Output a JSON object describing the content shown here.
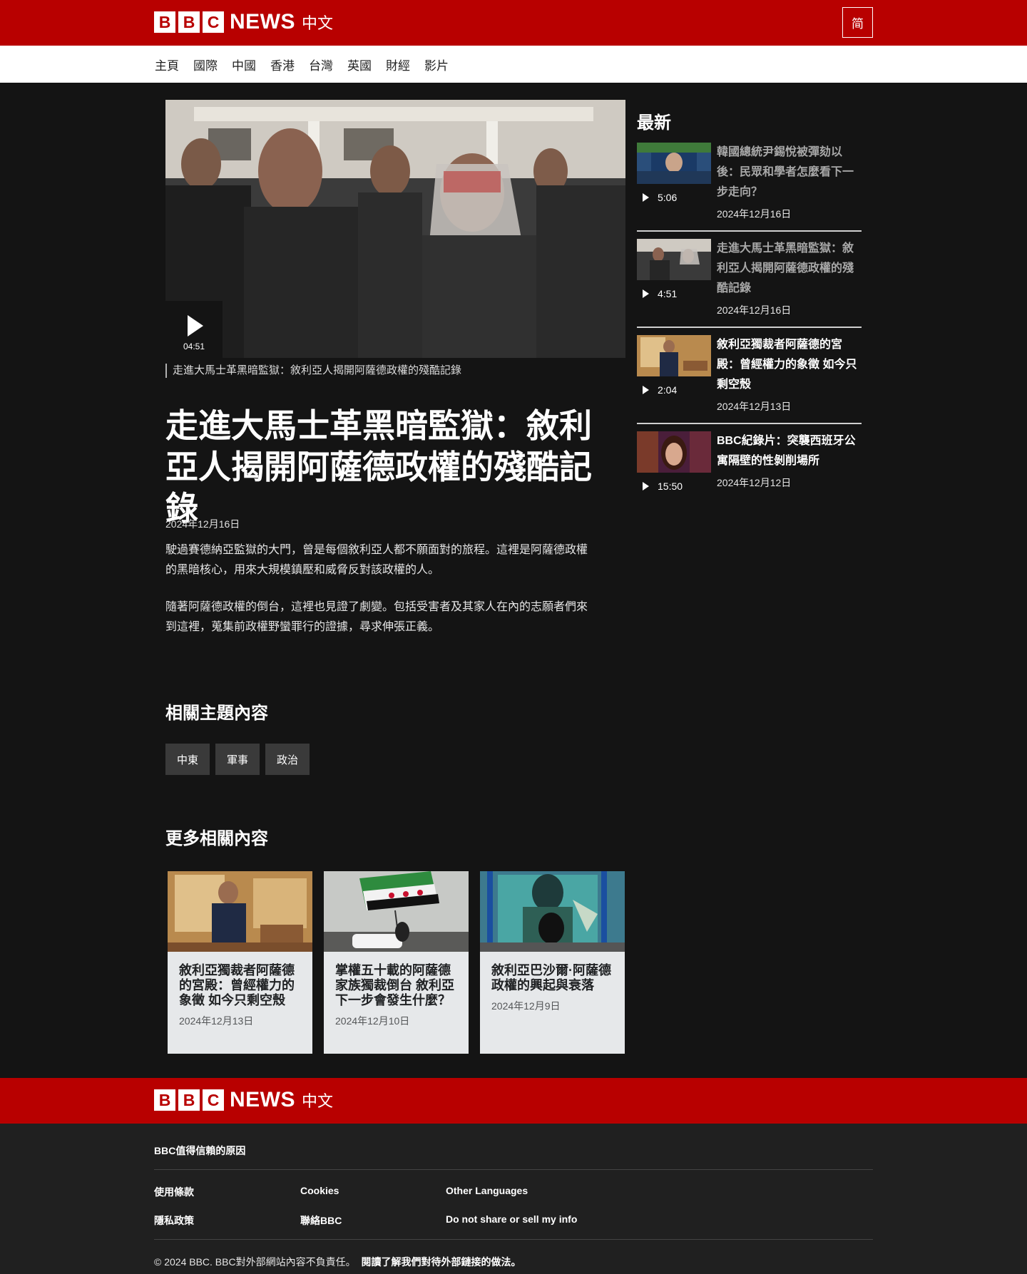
{
  "brand": {
    "blocks": [
      "B",
      "B",
      "C"
    ],
    "news": "NEWS",
    "lang": "中文"
  },
  "header": {
    "variant_button": "简"
  },
  "nav": {
    "items": [
      "主頁",
      "國際",
      "中國",
      "香港",
      "台灣",
      "英國",
      "財經",
      "影片"
    ]
  },
  "video": {
    "duration": "04:51",
    "caption": "走進大馬士革黑暗監獄：敘利亞人揭開阿薩德政權的殘酷記錄"
  },
  "article": {
    "headline": "走進大馬士革黑暗監獄：敘利亞人揭開阿薩德政權的殘酷記錄",
    "date": "2024年12月16日",
    "paragraphs": [
      "駛過賽德納亞監獄的大門，曾是每個敘利亞人都不願面對的旅程。這裡是阿薩德政權的黑暗核心，用來大規模鎮壓和威脅反對該政權的人。",
      "隨著阿薩德政權的倒台，這裡也見證了劇變。包括受害者及其家人在內的志願者們來到這裡，蒐集前政權野蠻罪行的證據，尋求伸張正義。"
    ]
  },
  "topics": {
    "heading": "相關主題內容",
    "items": [
      "中東",
      "軍事",
      "政治"
    ]
  },
  "more": {
    "heading": "更多相關內容",
    "cards": [
      {
        "title": "敘利亞獨裁者阿薩德的宮殿：曾經權力的象徵 如今只剩空殼",
        "date": "2024年12月13日"
      },
      {
        "title": "掌權五十載的阿薩德家族獨裁倒台 敘利亞下一步會發生什麼？",
        "date": "2024年12月10日"
      },
      {
        "title": "敘利亞巴沙爾·阿薩德政權的興起與衰落",
        "date": "2024年12月9日"
      }
    ]
  },
  "sidebar": {
    "heading": "最新",
    "items": [
      {
        "title": "韓國總統尹錫悅被彈劾以後：民眾和學者怎麼看下一步走向？",
        "duration": "5:06",
        "date": "2024年12月16日",
        "visited": true
      },
      {
        "title": "走進大馬士革黑暗監獄：敘利亞人揭開阿薩德政權的殘酷記錄",
        "duration": "4:51",
        "date": "2024年12月16日",
        "visited": true
      },
      {
        "title": "敘利亞獨裁者阿薩德的宮殿：曾經權力的象徵 如今只剩空殼",
        "duration": "2:04",
        "date": "2024年12月13日",
        "visited": false
      },
      {
        "title": "BBC紀錄片：突襲西班牙公寓隔壁的性剝削場所",
        "duration": "15:50",
        "date": "2024年12月12日",
        "visited": false
      }
    ]
  },
  "footer": {
    "trust": "BBC值得信賴的原因",
    "links": {
      "terms": "使用條款",
      "cookies": "Cookies",
      "languages": "Other Languages",
      "privacy": "隱私政策",
      "contact": "聯絡BBC",
      "do_not_sell": "Do not share or sell my info"
    },
    "copyright": "© 2024 BBC. BBC對外部網站內容不負責任。",
    "external_link": "閱讀了解我們對待外部鏈接的做法。"
  },
  "colors": {
    "brand_red": "#b80000",
    "page_bg": "#141414",
    "footer_bg": "#202020",
    "card_bg": "#e6e8ea"
  }
}
